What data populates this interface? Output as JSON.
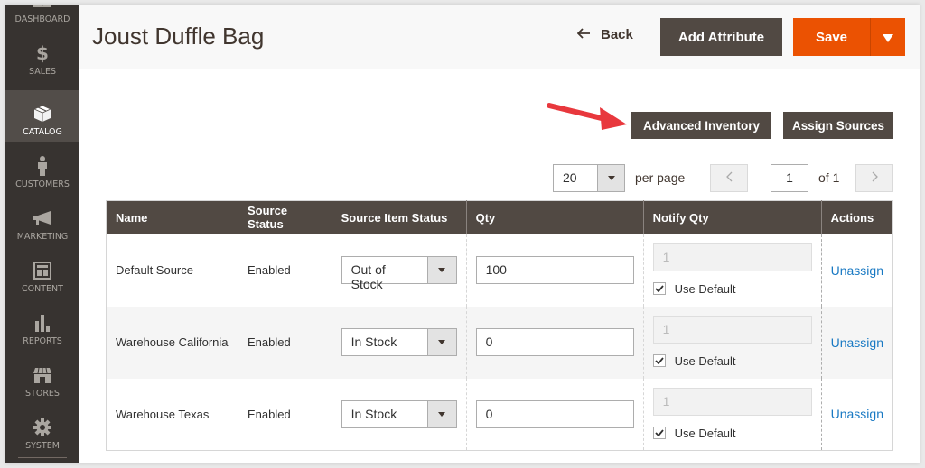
{
  "sidebar": {
    "items": [
      {
        "label": "DASHBOARD",
        "icon": "dashboard-icon",
        "active": false
      },
      {
        "label": "SALES",
        "icon": "dollar-icon",
        "active": false
      },
      {
        "label": "CATALOG",
        "icon": "box-icon",
        "active": true
      },
      {
        "label": "CUSTOMERS",
        "icon": "person-icon",
        "active": false
      },
      {
        "label": "MARKETING",
        "icon": "megaphone-icon",
        "active": false
      },
      {
        "label": "CONTENT",
        "icon": "layout-icon",
        "active": false
      },
      {
        "label": "REPORTS",
        "icon": "bar-chart-icon",
        "active": false
      },
      {
        "label": "STORES",
        "icon": "storefront-icon",
        "active": false
      },
      {
        "label": "SYSTEM",
        "icon": "gear-icon",
        "active": false
      }
    ]
  },
  "header": {
    "title": "Joust Duffle Bag",
    "back_label": "Back",
    "add_attribute_label": "Add Attribute",
    "save_label": "Save"
  },
  "actions": {
    "advanced_inventory_label": "Advanced Inventory",
    "assign_sources_label": "Assign Sources"
  },
  "pager": {
    "per_page_value": "20",
    "per_page_label": "per page",
    "current_page": "1",
    "of_label": "of 1"
  },
  "table": {
    "columns": [
      "Name",
      "Source Status",
      "Source Item Status",
      "Qty",
      "Notify Qty",
      "Actions"
    ],
    "rows": [
      {
        "name": "Default Source",
        "source_status": "Enabled",
        "item_status": "Out of Stock",
        "qty": "100",
        "notify_qty": "1",
        "use_default_label": "Use Default",
        "use_default_checked": true,
        "action": "Unassign"
      },
      {
        "name": "Warehouse California",
        "source_status": "Enabled",
        "item_status": "In Stock",
        "qty": "0",
        "notify_qty": "1",
        "use_default_label": "Use Default",
        "use_default_checked": true,
        "action": "Unassign"
      },
      {
        "name": "Warehouse Texas",
        "source_status": "Enabled",
        "item_status": "In Stock",
        "qty": "0",
        "notify_qty": "1",
        "use_default_label": "Use Default",
        "use_default_checked": true,
        "action": "Unassign"
      }
    ]
  },
  "colors": {
    "sidebar_bg": "#373330",
    "sidebar_active": "#524d49",
    "primary_orange": "#eb5202",
    "dark_button": "#514943",
    "link_blue": "#1979c3",
    "annotation_arrow": "#e8383d"
  }
}
